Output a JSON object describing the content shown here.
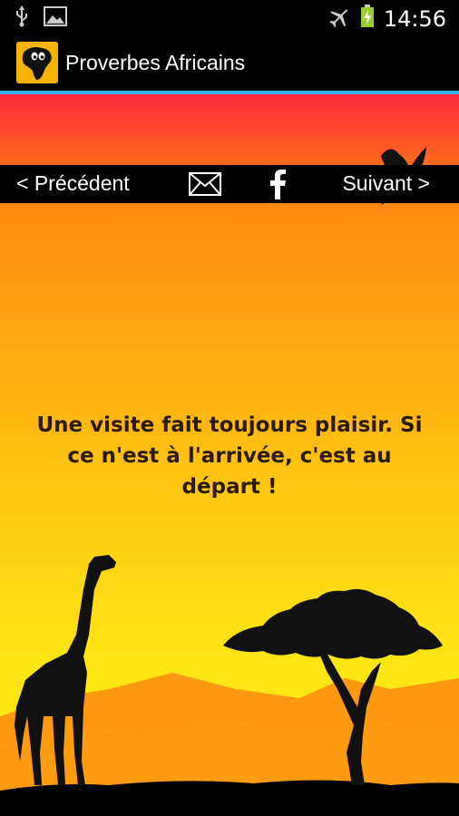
{
  "status_bar": {
    "time": "14:56",
    "icons": [
      "usb-icon",
      "image-icon",
      "airplane-icon",
      "battery-charging-icon"
    ]
  },
  "action_bar": {
    "title": "Proverbes Africains",
    "logo": "africa-map-logo"
  },
  "navigation": {
    "previous_label": "< Précédent",
    "next_label": "Suivant >",
    "share_mail_icon": "mail-icon",
    "share_facebook_icon": "facebook-icon"
  },
  "proverb": {
    "text": "Une visite fait toujours plaisir. Si ce n'est à l'arrivée, c'est au départ !"
  },
  "colors": {
    "accent": "#33b5e5",
    "sky_top": "#ff2a3c",
    "sky_bottom": "#ffec18",
    "text": "#2b1a05"
  }
}
